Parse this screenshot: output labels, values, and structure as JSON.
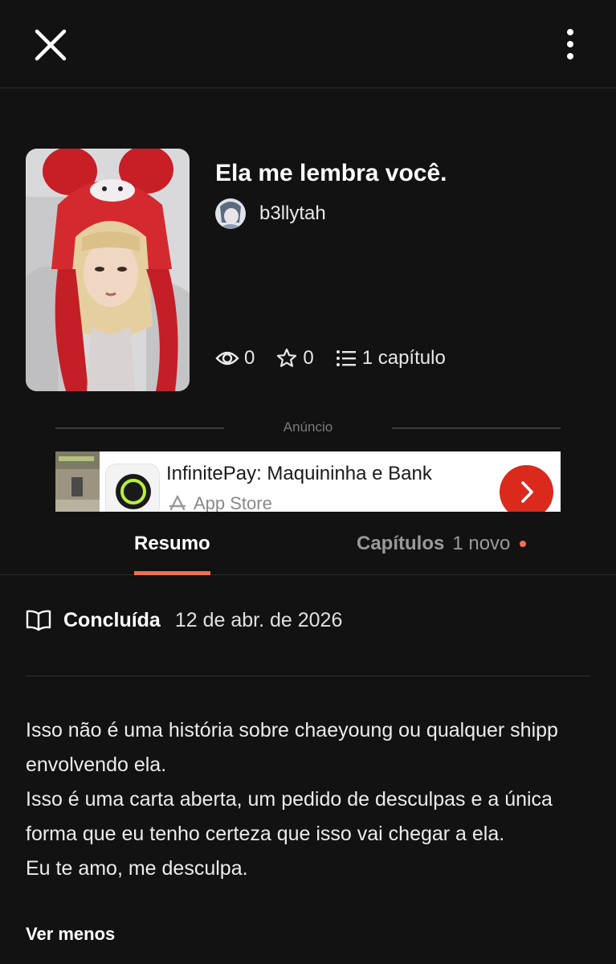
{
  "header": {
    "close_icon": "close-icon",
    "more_icon": "more-vertical-icon"
  },
  "story": {
    "title": "Ela me lembra você.",
    "author": "b3llytah",
    "stats": {
      "views": "0",
      "votes": "0",
      "chapters": "1 capítulo"
    }
  },
  "ad": {
    "label": "Anúncio",
    "title": "InfinitePay: Maquininha e Bank",
    "store": "App Store",
    "accent_color": "#d92a1c"
  },
  "tabs": {
    "summary": "Resumo",
    "chapters": "Capítulos",
    "chapters_new": "1 novo",
    "active_color": "#f07050"
  },
  "details": {
    "status": "Concluída",
    "date": "12 de abr. de 2026"
  },
  "description": {
    "paragraphs": [
      "Isso não é uma história sobre chaeyoung ou qualquer shipp envolvendo ela.",
      "Isso é uma carta aberta, um pedido de desculpas e a única forma que eu tenho certeza que isso vai chegar a ela.",
      "Eu te amo, me desculpa."
    ],
    "see_less": "Ver menos"
  }
}
